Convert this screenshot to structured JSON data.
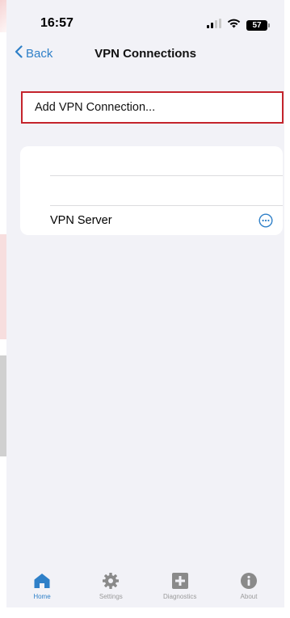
{
  "status_bar": {
    "time": "16:57",
    "battery": "57"
  },
  "nav": {
    "back_label": "Back",
    "title": "VPN Connections"
  },
  "add_connection": {
    "label": "Add VPN Connection..."
  },
  "connections": [
    {
      "label": ""
    },
    {
      "label": ""
    },
    {
      "label": "VPN Server"
    }
  ],
  "tabs": [
    {
      "label": "Home",
      "icon": "home-icon",
      "active": true
    },
    {
      "label": "Settings",
      "icon": "gear-icon",
      "active": false
    },
    {
      "label": "Diagnostics",
      "icon": "plus-box-icon",
      "active": false
    },
    {
      "label": "About",
      "icon": "info-icon",
      "active": false
    }
  ],
  "colors": {
    "accent": "#2f80c8",
    "highlight_border": "#c4242c",
    "background": "#f2f2f7"
  }
}
